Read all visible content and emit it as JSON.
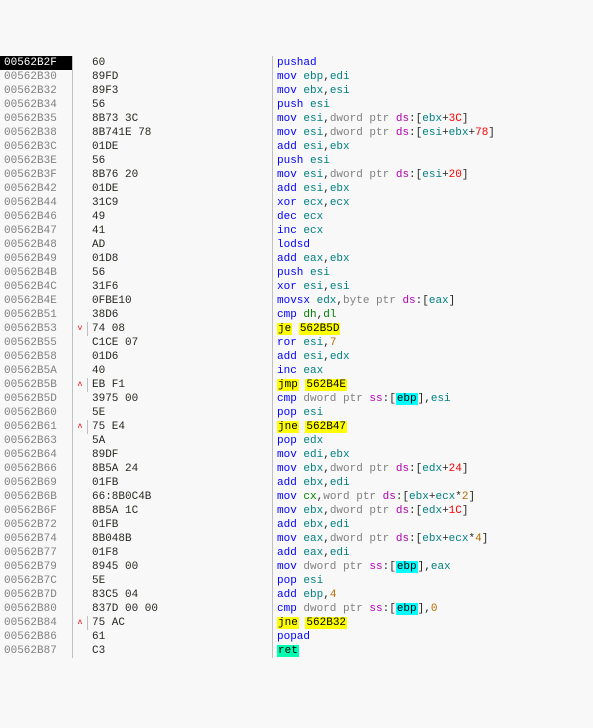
{
  "rows": [
    {
      "addr": "00562B2F",
      "sel": true,
      "jmp": "",
      "bytes": "60",
      "dis": [
        [
          "mne",
          "pushad"
        ]
      ]
    },
    {
      "addr": "00562B30",
      "jmp": "",
      "bytes": "89FD",
      "dis": [
        [
          "mne",
          "mov "
        ],
        [
          "reg",
          "ebp"
        ],
        [
          "txt",
          ","
        ],
        [
          "reg",
          "edi"
        ]
      ]
    },
    {
      "addr": "00562B32",
      "jmp": "",
      "bytes": "89F3",
      "dis": [
        [
          "mne",
          "mov "
        ],
        [
          "reg",
          "ebx"
        ],
        [
          "txt",
          ","
        ],
        [
          "reg",
          "esi"
        ]
      ]
    },
    {
      "addr": "00562B34",
      "jmp": "",
      "bytes": "56",
      "dis": [
        [
          "mne",
          "push "
        ],
        [
          "reg",
          "esi"
        ]
      ]
    },
    {
      "addr": "00562B35",
      "jmp": "",
      "bytes": "8B73 3C",
      "dis": [
        [
          "mne",
          "mov "
        ],
        [
          "reg",
          "esi"
        ],
        [
          "txt",
          ","
        ],
        [
          "gray",
          "dword ptr "
        ],
        [
          "segp",
          "ds"
        ],
        [
          "txt",
          ":["
        ],
        [
          "reg",
          "ebx"
        ],
        [
          "txt",
          "+"
        ],
        [
          "addr",
          "3C"
        ],
        [
          "txt",
          "]"
        ]
      ]
    },
    {
      "addr": "00562B38",
      "jmp": "",
      "bytes": "8B741E 78",
      "dis": [
        [
          "mne",
          "mov "
        ],
        [
          "reg",
          "esi"
        ],
        [
          "txt",
          ","
        ],
        [
          "gray",
          "dword ptr "
        ],
        [
          "segp",
          "ds"
        ],
        [
          "txt",
          ":["
        ],
        [
          "reg",
          "esi"
        ],
        [
          "txt",
          "+"
        ],
        [
          "reg",
          "ebx"
        ],
        [
          "txt",
          "+"
        ],
        [
          "addr",
          "78"
        ],
        [
          "txt",
          "]"
        ]
      ]
    },
    {
      "addr": "00562B3C",
      "jmp": "",
      "bytes": "01DE",
      "dis": [
        [
          "mne",
          "add "
        ],
        [
          "reg",
          "esi"
        ],
        [
          "txt",
          ","
        ],
        [
          "reg",
          "ebx"
        ]
      ]
    },
    {
      "addr": "00562B3E",
      "jmp": "",
      "bytes": "56",
      "dis": [
        [
          "mne",
          "push "
        ],
        [
          "reg",
          "esi"
        ]
      ]
    },
    {
      "addr": "00562B3F",
      "jmp": "",
      "bytes": "8B76 20",
      "dis": [
        [
          "mne",
          "mov "
        ],
        [
          "reg",
          "esi"
        ],
        [
          "txt",
          ","
        ],
        [
          "gray",
          "dword ptr "
        ],
        [
          "segp",
          "ds"
        ],
        [
          "txt",
          ":["
        ],
        [
          "reg",
          "esi"
        ],
        [
          "txt",
          "+"
        ],
        [
          "addr",
          "20"
        ],
        [
          "txt",
          "]"
        ]
      ]
    },
    {
      "addr": "00562B42",
      "jmp": "",
      "bytes": "01DE",
      "dis": [
        [
          "mne",
          "add "
        ],
        [
          "reg",
          "esi"
        ],
        [
          "txt",
          ","
        ],
        [
          "reg",
          "ebx"
        ]
      ]
    },
    {
      "addr": "00562B44",
      "jmp": "",
      "bytes": "31C9",
      "dis": [
        [
          "mne",
          "xor "
        ],
        [
          "reg",
          "ecx"
        ],
        [
          "txt",
          ","
        ],
        [
          "reg",
          "ecx"
        ]
      ]
    },
    {
      "addr": "00562B46",
      "jmp": "",
      "bytes": "49",
      "dis": [
        [
          "mne",
          "dec "
        ],
        [
          "reg",
          "ecx"
        ]
      ]
    },
    {
      "addr": "00562B47",
      "jmp": "",
      "bytes": "41",
      "dis": [
        [
          "mne",
          "inc "
        ],
        [
          "reg",
          "ecx"
        ]
      ]
    },
    {
      "addr": "00562B48",
      "jmp": "",
      "bytes": "AD",
      "dis": [
        [
          "mne",
          "lodsd"
        ]
      ]
    },
    {
      "addr": "00562B49",
      "jmp": "",
      "bytes": "01D8",
      "dis": [
        [
          "mne",
          "add "
        ],
        [
          "reg",
          "eax"
        ],
        [
          "txt",
          ","
        ],
        [
          "reg",
          "ebx"
        ]
      ]
    },
    {
      "addr": "00562B4B",
      "jmp": "",
      "bytes": "56",
      "dis": [
        [
          "mne",
          "push "
        ],
        [
          "reg",
          "esi"
        ]
      ]
    },
    {
      "addr": "00562B4C",
      "jmp": "",
      "bytes": "31F6",
      "dis": [
        [
          "mne",
          "xor "
        ],
        [
          "reg",
          "esi"
        ],
        [
          "txt",
          ","
        ],
        [
          "reg",
          "esi"
        ]
      ]
    },
    {
      "addr": "00562B4E",
      "jmp": "",
      "bytes": "0FBE10",
      "dis": [
        [
          "mne",
          "movsx "
        ],
        [
          "reg",
          "edx"
        ],
        [
          "txt",
          ","
        ],
        [
          "gray",
          "byte ptr "
        ],
        [
          "segp",
          "ds"
        ],
        [
          "txt",
          ":["
        ],
        [
          "reg",
          "eax"
        ],
        [
          "txt",
          "]"
        ]
      ]
    },
    {
      "addr": "00562B51",
      "jmp": "",
      "bytes": "38D6",
      "dis": [
        [
          "mne",
          "cmp "
        ],
        [
          "regb",
          "dh"
        ],
        [
          "txt",
          ","
        ],
        [
          "regb",
          "dl"
        ]
      ]
    },
    {
      "addr": "00562B53",
      "jmp": "˅",
      "bytes": "74 08",
      "dis": [
        [
          "hl-y",
          "je"
        ],
        [
          "txt",
          " "
        ],
        [
          "hl-y",
          "562B5D"
        ]
      ]
    },
    {
      "addr": "00562B55",
      "jmp": "",
      "bytes": "C1CE 07",
      "dis": [
        [
          "mne",
          "ror "
        ],
        [
          "reg",
          "esi"
        ],
        [
          "txt",
          ","
        ],
        [
          "num",
          "7"
        ]
      ]
    },
    {
      "addr": "00562B58",
      "jmp": "",
      "bytes": "01D6",
      "dis": [
        [
          "mne",
          "add "
        ],
        [
          "reg",
          "esi"
        ],
        [
          "txt",
          ","
        ],
        [
          "reg",
          "edx"
        ]
      ]
    },
    {
      "addr": "00562B5A",
      "jmp": "",
      "bytes": "40",
      "dis": [
        [
          "mne",
          "inc "
        ],
        [
          "reg",
          "eax"
        ]
      ]
    },
    {
      "addr": "00562B5B",
      "jmp": "˄",
      "bytes": "EB F1",
      "dis": [
        [
          "hl-y",
          "jmp"
        ],
        [
          "txt",
          " "
        ],
        [
          "hl-y",
          "562B4E"
        ]
      ]
    },
    {
      "addr": "00562B5D",
      "jmp": "",
      "bytes": "3975 00",
      "dis": [
        [
          "mne",
          "cmp "
        ],
        [
          "gray",
          "dword ptr "
        ],
        [
          "segp",
          "ss"
        ],
        [
          "txt",
          ":["
        ],
        [
          "hl-c",
          "ebp"
        ],
        [
          "txt",
          "],"
        ],
        [
          "reg",
          "esi"
        ]
      ]
    },
    {
      "addr": "00562B60",
      "jmp": "",
      "bytes": "5E",
      "dis": [
        [
          "mne",
          "pop "
        ],
        [
          "reg",
          "esi"
        ]
      ]
    },
    {
      "addr": "00562B61",
      "jmp": "˄",
      "bytes": "75 E4",
      "dis": [
        [
          "hl-y",
          "jne"
        ],
        [
          "txt",
          " "
        ],
        [
          "hl-y",
          "562B47"
        ]
      ]
    },
    {
      "addr": "00562B63",
      "jmp": "",
      "bytes": "5A",
      "dis": [
        [
          "mne",
          "pop "
        ],
        [
          "reg",
          "edx"
        ]
      ]
    },
    {
      "addr": "00562B64",
      "jmp": "",
      "bytes": "89DF",
      "dis": [
        [
          "mne",
          "mov "
        ],
        [
          "reg",
          "edi"
        ],
        [
          "txt",
          ","
        ],
        [
          "reg",
          "ebx"
        ]
      ]
    },
    {
      "addr": "00562B66",
      "jmp": "",
      "bytes": "8B5A 24",
      "dis": [
        [
          "mne",
          "mov "
        ],
        [
          "reg",
          "ebx"
        ],
        [
          "txt",
          ","
        ],
        [
          "gray",
          "dword ptr "
        ],
        [
          "segp",
          "ds"
        ],
        [
          "txt",
          ":["
        ],
        [
          "reg",
          "edx"
        ],
        [
          "txt",
          "+"
        ],
        [
          "addr",
          "24"
        ],
        [
          "txt",
          "]"
        ]
      ]
    },
    {
      "addr": "00562B69",
      "jmp": "",
      "bytes": "01FB",
      "dis": [
        [
          "mne",
          "add "
        ],
        [
          "reg",
          "ebx"
        ],
        [
          "txt",
          ","
        ],
        [
          "reg",
          "edi"
        ]
      ]
    },
    {
      "addr": "00562B6B",
      "jmp": "",
      "bytes": "66:8B0C4B",
      "dis": [
        [
          "mne",
          "mov "
        ],
        [
          "regb",
          "cx"
        ],
        [
          "txt",
          ","
        ],
        [
          "gray",
          "word ptr "
        ],
        [
          "segp",
          "ds"
        ],
        [
          "txt",
          ":["
        ],
        [
          "reg",
          "ebx"
        ],
        [
          "txt",
          "+"
        ],
        [
          "reg",
          "ecx"
        ],
        [
          "txt",
          "*"
        ],
        [
          "num",
          "2"
        ],
        [
          "txt",
          "]"
        ]
      ]
    },
    {
      "addr": "00562B6F",
      "jmp": "",
      "bytes": "8B5A 1C",
      "dis": [
        [
          "mne",
          "mov "
        ],
        [
          "reg",
          "ebx"
        ],
        [
          "txt",
          ","
        ],
        [
          "gray",
          "dword ptr "
        ],
        [
          "segp",
          "ds"
        ],
        [
          "txt",
          ":["
        ],
        [
          "reg",
          "edx"
        ],
        [
          "txt",
          "+"
        ],
        [
          "addr",
          "1C"
        ],
        [
          "txt",
          "]"
        ]
      ]
    },
    {
      "addr": "00562B72",
      "jmp": "",
      "bytes": "01FB",
      "dis": [
        [
          "mne",
          "add "
        ],
        [
          "reg",
          "ebx"
        ],
        [
          "txt",
          ","
        ],
        [
          "reg",
          "edi"
        ]
      ]
    },
    {
      "addr": "00562B74",
      "jmp": "",
      "bytes": "8B048B",
      "dis": [
        [
          "mne",
          "mov "
        ],
        [
          "reg",
          "eax"
        ],
        [
          "txt",
          ","
        ],
        [
          "gray",
          "dword ptr "
        ],
        [
          "segp",
          "ds"
        ],
        [
          "txt",
          ":["
        ],
        [
          "reg",
          "ebx"
        ],
        [
          "txt",
          "+"
        ],
        [
          "reg",
          "ecx"
        ],
        [
          "txt",
          "*"
        ],
        [
          "num",
          "4"
        ],
        [
          "txt",
          "]"
        ]
      ]
    },
    {
      "addr": "00562B77",
      "jmp": "",
      "bytes": "01F8",
      "dis": [
        [
          "mne",
          "add "
        ],
        [
          "reg",
          "eax"
        ],
        [
          "txt",
          ","
        ],
        [
          "reg",
          "edi"
        ]
      ]
    },
    {
      "addr": "00562B79",
      "jmp": "",
      "bytes": "8945 00",
      "dis": [
        [
          "mne",
          "mov "
        ],
        [
          "gray",
          "dword ptr "
        ],
        [
          "segp",
          "ss"
        ],
        [
          "txt",
          ":["
        ],
        [
          "hl-c",
          "ebp"
        ],
        [
          "txt",
          "],"
        ],
        [
          "reg",
          "eax"
        ]
      ]
    },
    {
      "addr": "00562B7C",
      "jmp": "",
      "bytes": "5E",
      "dis": [
        [
          "mne",
          "pop "
        ],
        [
          "reg",
          "esi"
        ]
      ]
    },
    {
      "addr": "00562B7D",
      "jmp": "",
      "bytes": "83C5 04",
      "dis": [
        [
          "mne",
          "add "
        ],
        [
          "reg",
          "ebp"
        ],
        [
          "txt",
          ","
        ],
        [
          "num",
          "4"
        ]
      ]
    },
    {
      "addr": "00562B80",
      "jmp": "",
      "bytes": "837D 00 00",
      "dis": [
        [
          "mne",
          "cmp "
        ],
        [
          "gray",
          "dword ptr "
        ],
        [
          "segp",
          "ss"
        ],
        [
          "txt",
          ":["
        ],
        [
          "hl-c",
          "ebp"
        ],
        [
          "txt",
          "],"
        ],
        [
          "num",
          "0"
        ]
      ]
    },
    {
      "addr": "00562B84",
      "jmp": "˄",
      "bytes": "75 AC",
      "dis": [
        [
          "hl-y",
          "jne"
        ],
        [
          "txt",
          " "
        ],
        [
          "hl-y",
          "562B32"
        ]
      ]
    },
    {
      "addr": "00562B86",
      "jmp": "",
      "bytes": "61",
      "dis": [
        [
          "mne",
          "popad"
        ]
      ]
    },
    {
      "addr": "00562B87",
      "jmp": "",
      "bytes": "C3",
      "dis": [
        [
          "hl-ret",
          "ret"
        ]
      ]
    }
  ]
}
